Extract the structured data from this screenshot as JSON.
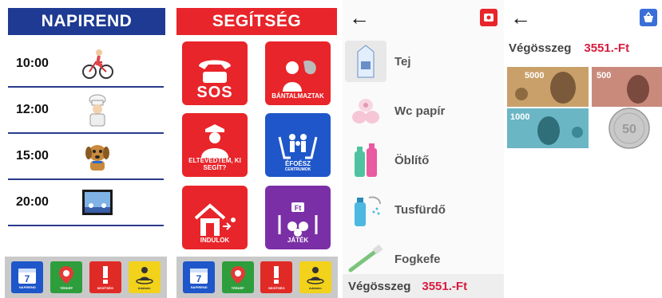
{
  "schedule": {
    "title": "NAPIREND",
    "rows": [
      {
        "time": "10:00",
        "icon": "cyclist-icon"
      },
      {
        "time": "12:00",
        "icon": "chef-icon"
      },
      {
        "time": "15:00",
        "icon": "dog-icon"
      },
      {
        "time": "20:00",
        "icon": "tv-icon"
      }
    ]
  },
  "nav": {
    "items": [
      {
        "label": "NAPIREND",
        "number": "7",
        "icon": "calendar-icon"
      },
      {
        "label": "TÉRKÉP",
        "icon": "map-pin-icon"
      },
      {
        "label": "SEGÍTSÉG",
        "icon": "exclamation-icon"
      },
      {
        "label": "Adataim",
        "icon": "person-icon"
      }
    ]
  },
  "help": {
    "title": "SEGÍTSÉG",
    "cards": [
      {
        "big": "SOS",
        "label": ""
      },
      {
        "big": "",
        "label": "BÁNTALMAZTAK"
      },
      {
        "big": "",
        "label": "ELTÉVEDTEM, KI SEGÍT?"
      },
      {
        "big": "",
        "label": "ÉFOÉSZ",
        "sub": "CENTRUMOK"
      },
      {
        "big": "",
        "label": "INDULOK"
      },
      {
        "big": "",
        "label": "JÁTÉK",
        "badge": "Ft"
      }
    ]
  },
  "shopping": {
    "items": [
      "Tej",
      "Wc papír",
      "Öblítő",
      "Tusfürdő",
      "Fogkefe"
    ],
    "total_label": "Végösszeg",
    "total_value": "3551.-Ft"
  },
  "money": {
    "total_label": "Végösszeg",
    "total_value": "3551.-Ft",
    "notes": [
      {
        "value": "5000",
        "color": "#b5874e"
      },
      {
        "value": "500",
        "color": "#b06a5a"
      },
      {
        "value": "1000",
        "color": "#4a9aa8"
      },
      {
        "value": "50",
        "color": "#c9c9c9"
      }
    ]
  },
  "colors": {
    "schedule_header": "#1f3a93",
    "help_header": "#e8252a",
    "price": "#d81b3f"
  }
}
